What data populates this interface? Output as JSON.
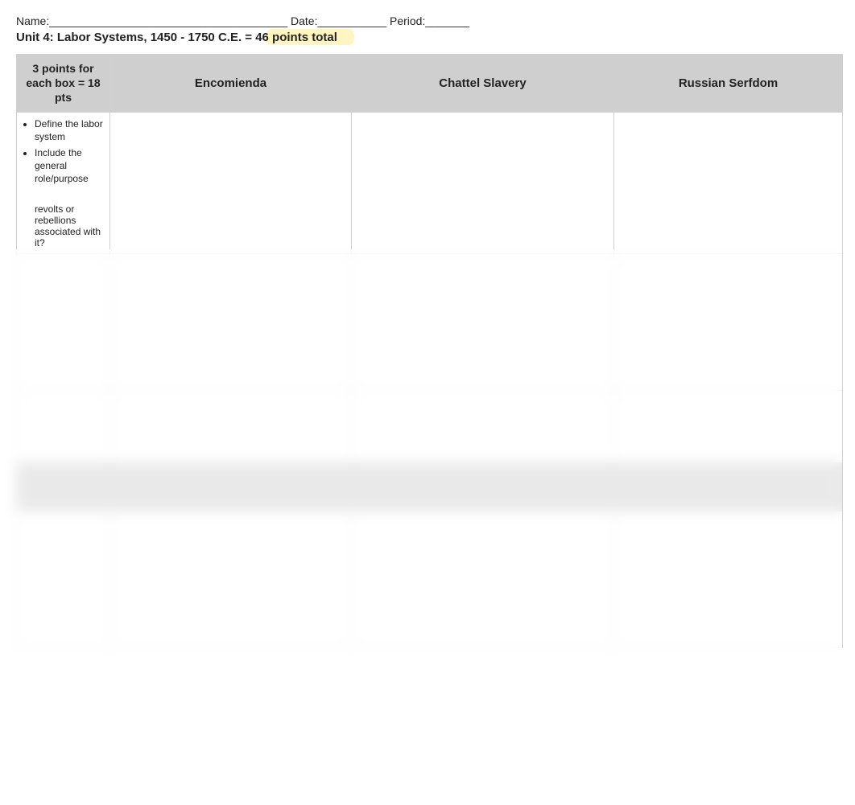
{
  "header": {
    "name_label": "Name:______________________________________",
    "date_label": "Date:___________",
    "period_label": "Period:_______",
    "unit_title": "Unit 4: Labor Systems, 1450 - 1750 C.E. = 46 points total"
  },
  "table1": {
    "points_header": "3 points for each box = 18 pts",
    "col_headers": [
      "Encomienda",
      "Chattel Slavery",
      "Russian Serfdom"
    ],
    "row1": {
      "prompt_items": [
        "Define the labor system",
        "Include the general role/purpose",
        "revolts or rebellions associated with it?"
      ],
      "cells": [
        "",
        "",
        ""
      ]
    },
    "row_blurred_a": {
      "prompt": "",
      "cells": [
        "",
        "",
        ""
      ]
    },
    "row_blurred_b": {
      "prompt": "",
      "cells": [
        "",
        "",
        ""
      ]
    }
  },
  "table2": {
    "points_header": "",
    "col_headers": [
      "",
      "",
      ""
    ],
    "row1": {
      "prompt": "",
      "cells": [
        "",
        "",
        ""
      ]
    }
  }
}
